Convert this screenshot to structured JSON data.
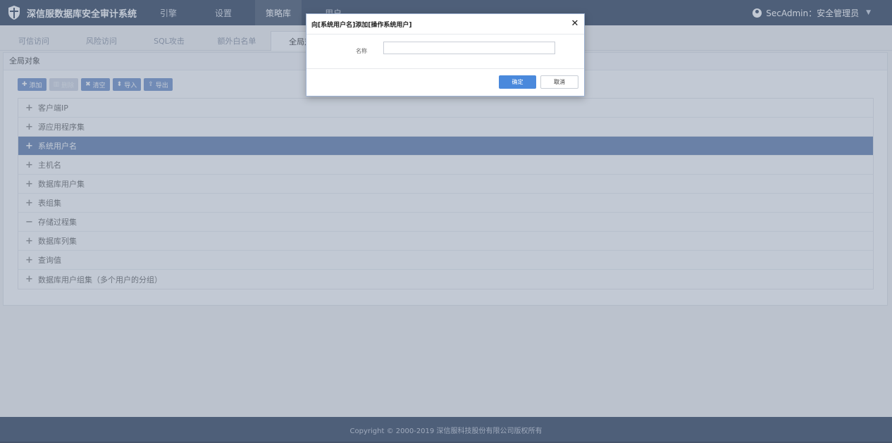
{
  "app": {
    "title": "深信服数据库安全审计系统"
  },
  "nav": {
    "items": [
      {
        "label": "引擎"
      },
      {
        "label": "设置"
      },
      {
        "label": "策略库"
      },
      {
        "label": "用户"
      }
    ]
  },
  "user": {
    "label": "SecAdmin：安全管理员"
  },
  "tabs": [
    {
      "label": "可信访问"
    },
    {
      "label": "风险访问"
    },
    {
      "label": "SQL攻击"
    },
    {
      "label": "额外白名单"
    },
    {
      "label": "全局对象"
    }
  ],
  "panel": {
    "title": "全局对象"
  },
  "toolbar": {
    "add": "添加",
    "delete": "删除",
    "clear": "清空",
    "import": "导入",
    "export": "导出"
  },
  "objects": [
    {
      "sign": "+",
      "label": "客户端IP"
    },
    {
      "sign": "+",
      "label": "源应用程序集"
    },
    {
      "sign": "+",
      "label": "系统用户名"
    },
    {
      "sign": "+",
      "label": "主机名"
    },
    {
      "sign": "+",
      "label": "数据库用户集"
    },
    {
      "sign": "+",
      "label": "表组集"
    },
    {
      "sign": "−",
      "label": "存储过程集"
    },
    {
      "sign": "+",
      "label": "数据库列集"
    },
    {
      "sign": "+",
      "label": "查询值"
    },
    {
      "sign": "+",
      "label": "数据库用户组集（多个用户的分组）"
    }
  ],
  "footer": {
    "copyright": "Copyright © 2000-2019 深信服科技股份有限公司版权所有"
  },
  "modal": {
    "title": "向[系统用户名]添加[操作系统用户]",
    "close_glyph": "✕",
    "field_label": "名称",
    "field_value": "",
    "ok_label": "确定",
    "cancel_label": "取消"
  },
  "colors": {
    "navbar": "#2d3e59",
    "selected_row": "#5f7dae",
    "primary_button": "#4a89dc"
  }
}
